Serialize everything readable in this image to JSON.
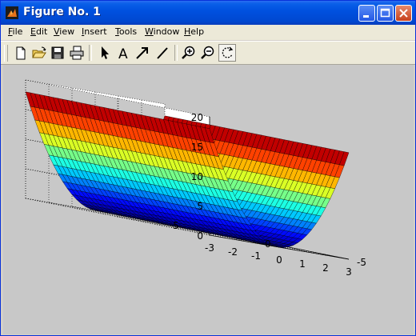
{
  "window": {
    "title": "Figure No. 1"
  },
  "menu": [
    "File",
    "Edit",
    "View",
    "Insert",
    "Tools",
    "Window",
    "Help"
  ],
  "toolbar": {
    "tools": [
      "new-figure",
      "open-file",
      "save-figure",
      "print-figure",
      "edit-plot",
      "insert-text",
      "insert-arrow",
      "insert-line",
      "zoom-in",
      "zoom-out",
      "rotate-3d"
    ],
    "active_tool": "rotate-3d"
  },
  "chart_data": {
    "type": "surface",
    "title": "",
    "xlabel": "",
    "ylabel": "",
    "zlabel": "",
    "x_ticks": [
      "-3",
      "-2",
      "-1",
      "0",
      "1",
      "2",
      "3"
    ],
    "y_ticks": [
      "-5",
      "0",
      "5"
    ],
    "z_ticks": [
      "0",
      "5",
      "10",
      "15",
      "20"
    ],
    "xlim": [
      -3,
      3
    ],
    "ylim": [
      -5,
      5
    ],
    "zlim": [
      0,
      20
    ],
    "grid": true,
    "colormap": "jet",
    "surface": {
      "equation": "z = 2*x^2",
      "x_range": [
        -3,
        3
      ],
      "y_range": [
        -5,
        5
      ]
    }
  }
}
